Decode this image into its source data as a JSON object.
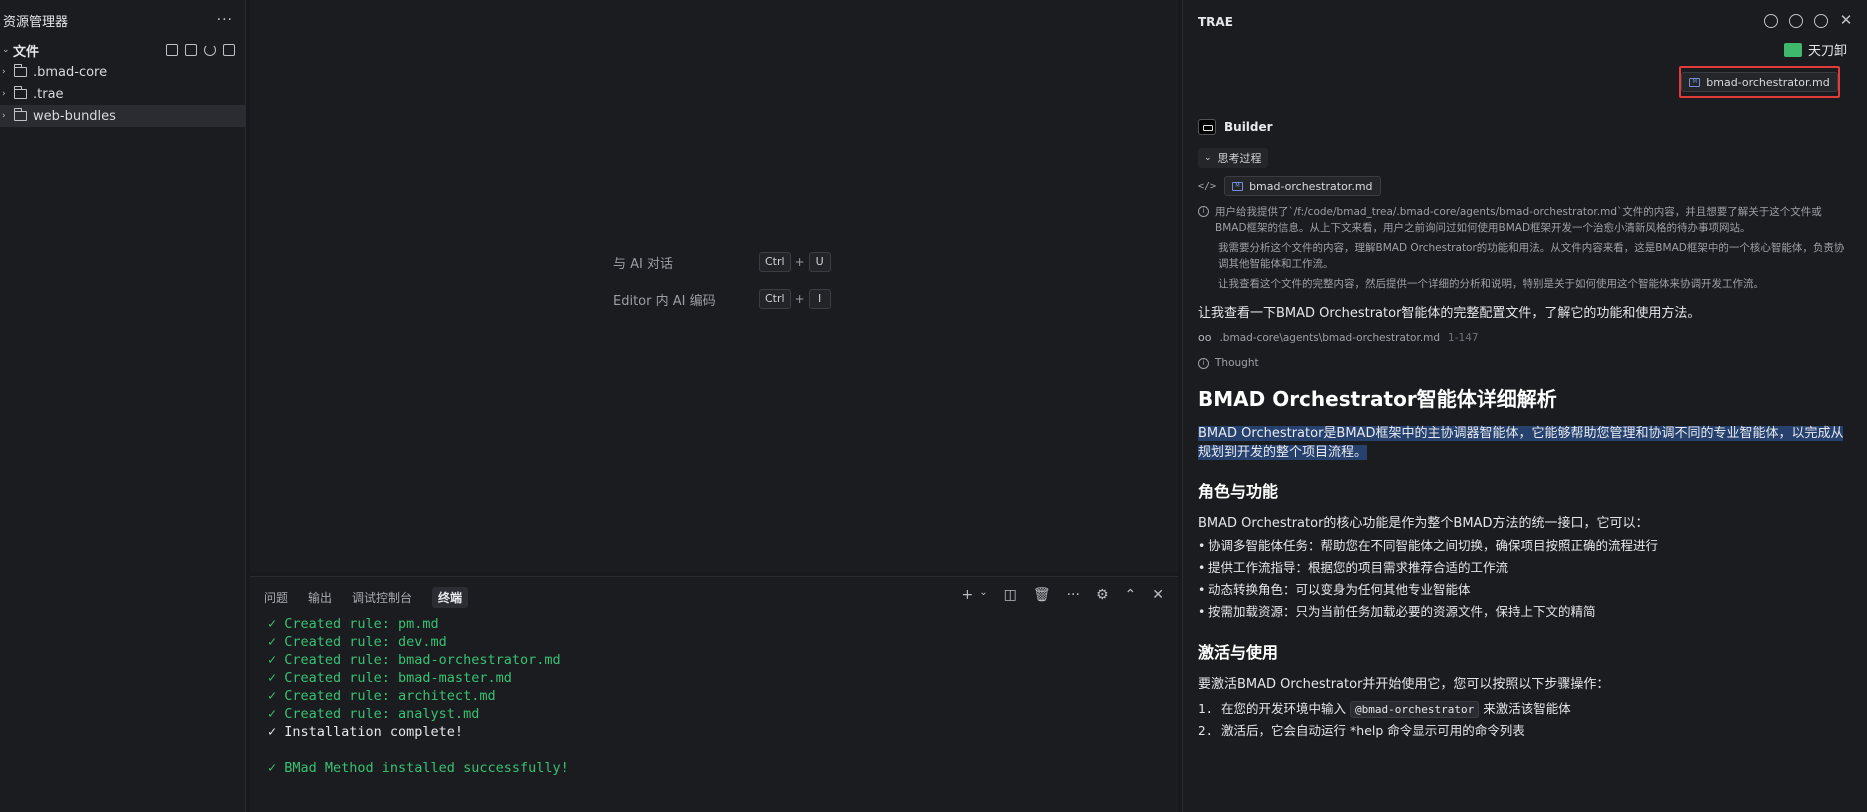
{
  "explorer": {
    "title": "资源管理器",
    "more": "···",
    "section": "文件",
    "items": [
      ".bmad-core",
      ".trae",
      "web-bundles"
    ]
  },
  "editor": {
    "hints": [
      {
        "label": "与 AI 对话",
        "k1": "Ctrl",
        "k2": "U"
      },
      {
        "label": "Editor 内 AI 编码",
        "k1": "Ctrl",
        "k2": "I"
      }
    ]
  },
  "panel": {
    "tabs": [
      "问题",
      "输出",
      "调试控制台",
      "终端"
    ],
    "terminal": [
      {
        "text": "✓ Created rule: pm.md",
        "kind": "ok"
      },
      {
        "text": "✓ Created rule: dev.md",
        "kind": "ok"
      },
      {
        "text": "✓ Created rule: bmad-orchestrator.md",
        "kind": "ok"
      },
      {
        "text": "✓ Created rule: bmad-master.md",
        "kind": "ok"
      },
      {
        "text": "✓ Created rule: architect.md",
        "kind": "ok"
      },
      {
        "text": "✓ Created rule: analyst.md",
        "kind": "ok"
      },
      {
        "text": "✓ Installation complete!",
        "kind": "plain"
      },
      {
        "text": "",
        "kind": "plain"
      },
      {
        "text": "✓ BMad Method installed successfully!",
        "kind": "ok"
      }
    ]
  },
  "side": {
    "title": "TRAE",
    "user": "天刀卸",
    "attached_file": "bmad-orchestrator.md",
    "builder": "Builder",
    "thinking_toggle": "思考过程",
    "code_file": "bmad-orchestrator.md",
    "thought_1": "用户给我提供了`/f:/code/bmad_trea/.bmad-core/agents/bmad-orchestrator.md`文件的内容，并且想要了解关于这个文件或BMAD框架的信息。从上下文来看，用户之前询问过如何使用BMAD框架开发一个治愈小清新风格的待办事项网站。",
    "thought_2": "我需要分析这个文件的内容，理解BMAD Orchestrator的功能和用法。从文件内容来看，这是BMAD框架中的一个核心智能体，负责协调其他智能体和工作流。",
    "thought_3": "让我查看这个文件的完整内容，然后提供一个详细的分析和说明，特别是关于如何使用这个智能体来协调开发工作流。",
    "main_line": "让我查看一下BMAD Orchestrator智能体的完整配置文件，了解它的功能和使用方法。",
    "read_path": ".bmad-core\\agents\\bmad-orchestrator.md",
    "read_range": "1-147",
    "thought_label": "Thought",
    "h1": "BMAD Orchestrator智能体详细解析",
    "highlight": "BMAD Orchestrator是BMAD框架中的主协调器智能体，它能够帮助您管理和协调不同的专业智能体，以完成从规划到开发的整个项目流程。",
    "h2_roles": "角色与功能",
    "roles_intro": "BMAD Orchestrator的核心功能是作为整个BMAD方法的统一接口，它可以：",
    "bullets": [
      "协调多智能体任务：帮助您在不同智能体之间切换，确保项目按照正确的流程进行",
      "提供工作流指导：根据您的项目需求推荐合适的工作流",
      "动态转换角色：可以变身为任何其他专业智能体",
      "按需加载资源：只为当前任务加载必要的资源文件，保持上下文的精简"
    ],
    "h2_activate": "激活与使用",
    "activate_intro": "要激活BMAD Orchestrator并开始使用它，您可以按照以下步骤操作：",
    "step1_num": "1.",
    "step1_a": "在您的开发环境中输入",
    "step1_code": "@bmad-orchestrator",
    "step1_b": "来激活该智能体",
    "step2_num": "2.",
    "step2_text": "激活后，它会自动运行 *help 命令显示可用的命令列表"
  }
}
